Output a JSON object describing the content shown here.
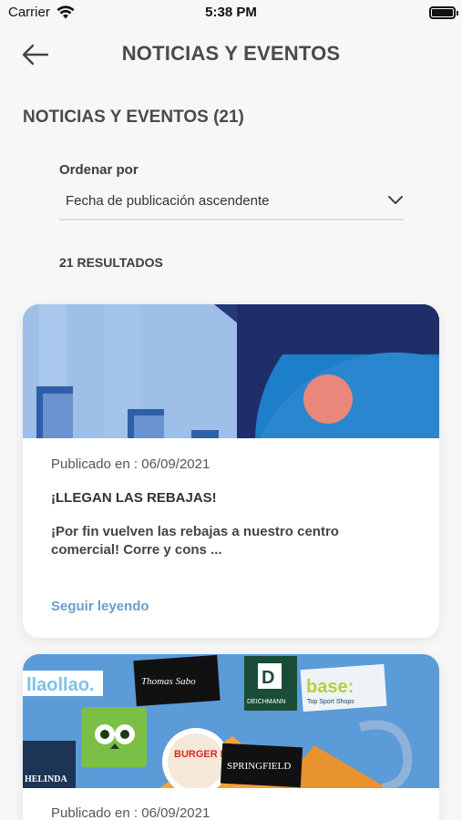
{
  "status_bar": {
    "carrier": "Carrier",
    "time": "5:38 PM"
  },
  "header": {
    "title": "NOTICIAS Y EVENTOS"
  },
  "section": {
    "title": "NOTICIAS Y EVENTOS",
    "count": "(21)"
  },
  "sort": {
    "label": "Ordenar por",
    "value": "Fecha de publicación ascendente"
  },
  "results": {
    "label": "21 RESULTADOS"
  },
  "news": [
    {
      "date": "Publicado en : 06/09/2021",
      "title": "¡LLEGAN LAS REBAJAS!",
      "excerpt": "¡Por fin vuelven las rebajas a nuestro centro comercial! Corre y cons ...",
      "read_more": "Seguir leyendo"
    },
    {
      "date": "Publicado en : 06/09/2021",
      "image_brands": [
        "llaollao.",
        "Thomas Sabo",
        "DEICHMANN",
        "base:",
        "Top Sport Shops",
        "BURGER KING",
        "SPRINGFIELD",
        "HELINDA"
      ]
    }
  ],
  "colors": {
    "link": "#6c9cc9",
    "background": "#f7f7f8",
    "title": "#4a4a4a"
  }
}
